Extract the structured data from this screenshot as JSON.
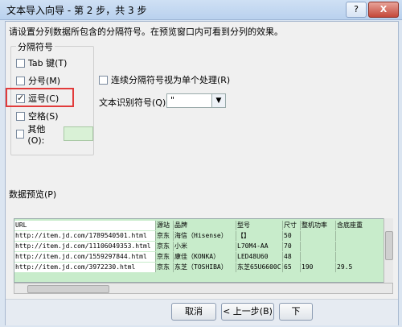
{
  "window": {
    "title": "文本导入向导 - 第 2 步，共 3 步",
    "help": "?",
    "close": "X"
  },
  "intro": "请设置分列数据所包含的分隔符号。在预览窗口内可看到分列的效果。",
  "delimiters": {
    "title": "分隔符号",
    "items": [
      {
        "label": "Tab 键(T)",
        "checked": false
      },
      {
        "label": "分号(M)",
        "checked": false
      },
      {
        "label": "逗号(C)",
        "checked": true
      },
      {
        "label": "空格(S)",
        "checked": false
      },
      {
        "label": "其他(O):",
        "checked": false
      }
    ]
  },
  "consecutive": {
    "label": "连续分隔符号视为单个处理(R)",
    "checked": false
  },
  "qualifier": {
    "label": "文本识别符号(Q):",
    "value": "\"",
    "arrow": "▼"
  },
  "preview": {
    "label": "数据预览(P)",
    "rows": [
      [
        "URL",
        "源站",
        "品牌",
        "型号",
        "尺寸",
        "整机功率",
        "含底座重"
      ],
      [
        "http://item.jd.com/1789540501.html",
        "京东",
        "海信（Hisense）",
        "【】",
        "50",
        "",
        ""
      ],
      [
        "http://item.jd.com/11106049353.html",
        "京东",
        "小米",
        "L70M4-AA",
        "70",
        "",
        ""
      ],
      [
        "http://item.jd.com/1559297844.html",
        "京东",
        "康佳（KONKA）",
        "LED48U60",
        "48",
        "",
        ""
      ],
      [
        "http://item.jd.com/3972230.html",
        "京东",
        "东芝（TOSHIBA）",
        "东芝65U6600C",
        "65",
        "190",
        "29.5"
      ]
    ]
  },
  "buttons": {
    "cancel": "取消",
    "back": "< 上一步(B)",
    "next": "下"
  },
  "scroll": {
    "up": "▲",
    "left": "◀"
  }
}
